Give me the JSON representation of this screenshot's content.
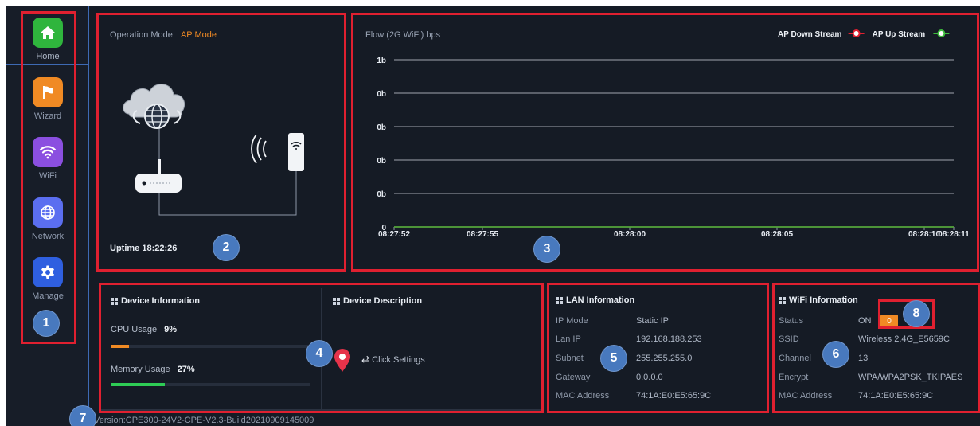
{
  "sidebar": {
    "items": [
      {
        "label": "Home",
        "icon": "home-icon",
        "color": "#2fb53d"
      },
      {
        "label": "Wizard",
        "icon": "flag-icon",
        "color": "#f08a24"
      },
      {
        "label": "WiFi",
        "icon": "wifi-icon",
        "color": "#8b4fe0"
      },
      {
        "label": "Network",
        "icon": "globe-icon",
        "color": "#5b6ef0"
      },
      {
        "label": "Manage",
        "icon": "gear-icon",
        "color": "#2f5fe0"
      }
    ]
  },
  "mode_panel": {
    "label": "Operation Mode",
    "value": "AP Mode",
    "uptime_label": "Uptime",
    "uptime_value": "18:22:26"
  },
  "flow_panel": {
    "title": "Flow (2G WiFi) bps"
  },
  "chart_data": {
    "type": "line",
    "title": "Flow (2G WiFi) bps",
    "y_tick_labels": [
      "1b",
      "0b",
      "0b",
      "0b",
      "0b",
      "0"
    ],
    "x_tick_labels": [
      "08:27:52",
      "08:27:55",
      "08:28:00",
      "08:28:05",
      "08:28:10",
      "08:28:11"
    ],
    "grid": true,
    "legend_position": "top-right",
    "series": [
      {
        "name": "AP Down Stream",
        "color": "#e02030",
        "values": [
          0,
          0,
          0,
          0,
          0,
          0
        ]
      },
      {
        "name": "AP Up Stream",
        "color": "#3dbb3d",
        "values": [
          0,
          0,
          0,
          0,
          0,
          0
        ]
      }
    ]
  },
  "device_info": {
    "title": "Device Information",
    "cpu_label": "CPU Usage",
    "cpu_value": "9%",
    "cpu_fraction": 0.09,
    "mem_label": "Memory Usage",
    "mem_value": "27%",
    "mem_fraction": 0.27,
    "cpu_color": "#f08a24",
    "mem_color": "#2ecc55"
  },
  "device_desc": {
    "title": "Device Description",
    "link": "Click Settings"
  },
  "lan_info": {
    "title": "LAN Information",
    "rows": [
      {
        "label": "IP Mode",
        "value": "Static IP"
      },
      {
        "label": "Lan IP",
        "value": "192.168.188.253"
      },
      {
        "label": "Subnet",
        "value": "255.255.255.0"
      },
      {
        "label": "Gateway",
        "value": "0.0.0.0"
      },
      {
        "label": "MAC Address",
        "value": "74:1A:E0:E5:65:9C"
      }
    ]
  },
  "wifi_info": {
    "title": "WiFi Information",
    "status_label": "Status",
    "status_value": "ON",
    "status_count": "0",
    "rows": [
      {
        "label": "SSID",
        "value": "Wireless 2.4G_E5659C"
      },
      {
        "label": "Channel",
        "value": "13"
      },
      {
        "label": "Encrypt",
        "value": "WPA/WPA2PSK_TKIPAES"
      },
      {
        "label": "MAC Address",
        "value": "74:1A:E0:E5:65:9C"
      }
    ]
  },
  "footer": {
    "version": "Version:CPE300-24V2-CPE-V2.3-Build20210909145009"
  },
  "callouts": [
    "1",
    "2",
    "3",
    "4",
    "5",
    "6",
    "7",
    "8"
  ]
}
